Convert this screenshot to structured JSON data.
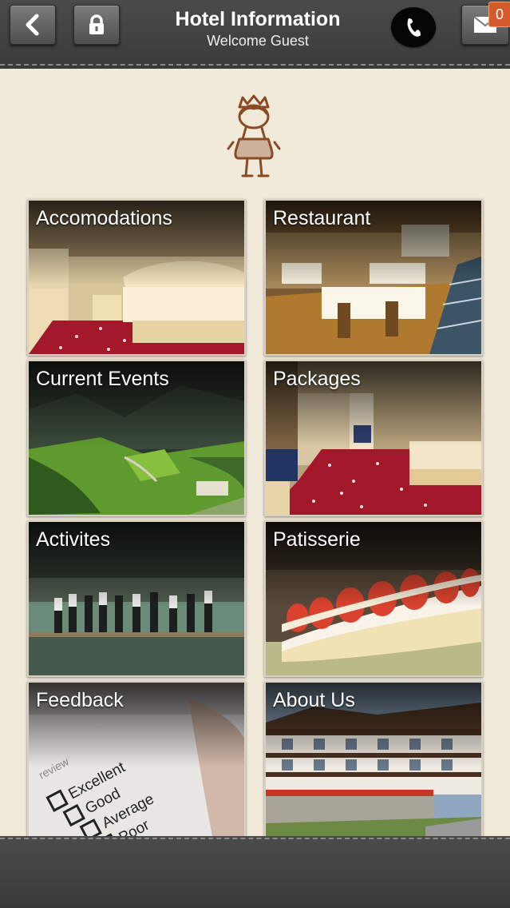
{
  "header": {
    "title": "Hotel Information",
    "subtitle": "Welcome Guest",
    "back_icon": "chevron-left-icon",
    "lock_icon": "lock-icon",
    "phone_icon": "phone-icon",
    "mail_icon": "envelope-icon",
    "mail_badge": "0"
  },
  "logo": {
    "icon": "hotel-mascot-logo"
  },
  "tiles": [
    {
      "label": "Accomodations"
    },
    {
      "label": "Restaurant"
    },
    {
      "label": "Current Events"
    },
    {
      "label": "Packages"
    },
    {
      "label": "Activites"
    },
    {
      "label": "Patisserie"
    },
    {
      "label": "Feedback",
      "sheet_lines": [
        "review",
        "Excellent",
        "Good",
        "Average",
        "Poor"
      ]
    },
    {
      "label": "About Us"
    }
  ],
  "colors": {
    "background": "#f1eadb",
    "bar": "#3f3f3f",
    "badge": "#d35a2a",
    "carpet": "#a3172b"
  }
}
